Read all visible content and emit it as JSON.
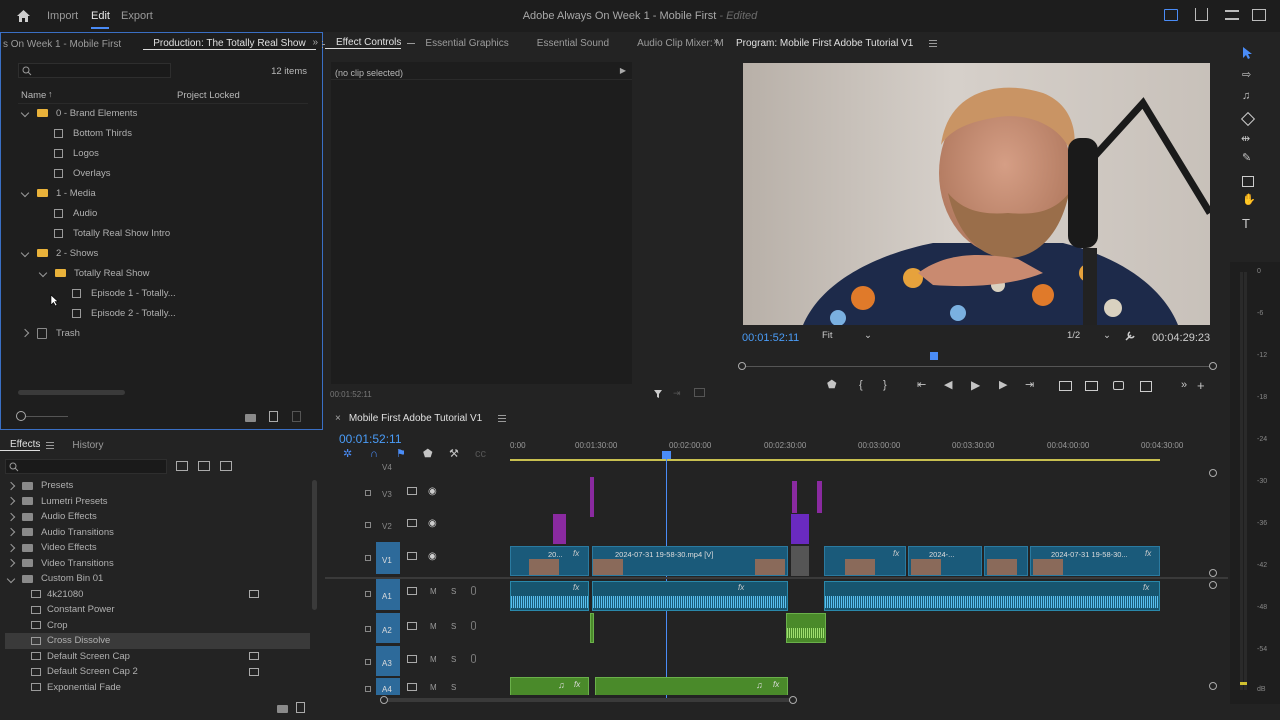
{
  "app": {
    "title": "Adobe Always On Week 1 - Mobile First",
    "edited": "- Edited"
  },
  "topnav": {
    "import": "Import",
    "edit": "Edit",
    "export": "Export"
  },
  "colors": {
    "accent": "#4a8cf7",
    "timecode": "#4a9cf7",
    "video_clip": "#1a5a7a",
    "audio_clip": "#17556f",
    "green_clip": "#4a8a2a",
    "purple_clip": "#8a2aa0",
    "folder": "#e9b23a"
  },
  "project": {
    "tab_prev": "s On Week 1 - Mobile First",
    "tab_active": "Production: The Totally Real Show",
    "items_count": "12 items",
    "col_name": "Name",
    "col_locked": "Project Locked",
    "rows": [
      {
        "label": "0 - Brand Elements",
        "type": "folder"
      },
      {
        "label": "Bottom Thirds",
        "type": "bin"
      },
      {
        "label": "Logos",
        "type": "bin"
      },
      {
        "label": "Overlays",
        "type": "bin"
      },
      {
        "label": "1 - Media",
        "type": "folder"
      },
      {
        "label": "Audio",
        "type": "bin"
      },
      {
        "label": "Totally Real Show Intro",
        "type": "bin"
      },
      {
        "label": "2 - Shows",
        "type": "folder"
      },
      {
        "label": "Totally Real Show",
        "type": "folder"
      },
      {
        "label": "Episode 1 - Totally...",
        "type": "bin"
      },
      {
        "label": "Episode 2 - Totally...",
        "type": "bin"
      },
      {
        "label": "Trash",
        "type": "trash"
      }
    ]
  },
  "effect_controls": {
    "tabs": [
      "Effect Controls",
      "Essential Graphics",
      "Essential Sound",
      "Audio Clip Mixer: M"
    ],
    "no_clip": "(no clip selected)",
    "timecode": "00:01:52:11"
  },
  "program": {
    "title": "Program: Mobile First Adobe Tutorial V1",
    "timecode": "00:01:52:11",
    "fit": "Fit",
    "resolution": "1/2",
    "duration": "00:04:29:23"
  },
  "effects": {
    "tab_active": "Effects",
    "tab_history": "History",
    "items": [
      {
        "label": "Presets",
        "kind": "folder"
      },
      {
        "label": "Lumetri Presets",
        "kind": "folder"
      },
      {
        "label": "Audio Effects",
        "kind": "folder"
      },
      {
        "label": "Audio Transitions",
        "kind": "folder"
      },
      {
        "label": "Video Effects",
        "kind": "folder"
      },
      {
        "label": "Video Transitions",
        "kind": "folder"
      },
      {
        "label": "Custom Bin 01",
        "kind": "folder-open"
      },
      {
        "label": "4k21080",
        "kind": "effect"
      },
      {
        "label": "Constant Power",
        "kind": "effect"
      },
      {
        "label": "Crop",
        "kind": "effect"
      },
      {
        "label": "Cross Dissolve",
        "kind": "effect"
      },
      {
        "label": "Default Screen Cap",
        "kind": "effect"
      },
      {
        "label": "Default Screen Cap 2",
        "kind": "effect"
      },
      {
        "label": "Exponential Fade",
        "kind": "effect"
      }
    ]
  },
  "timeline": {
    "title": "Mobile First Adobe Tutorial V1",
    "timecode": "00:01:52:11",
    "ruler": [
      "0:00",
      "00:01:30:00",
      "00:02:00:00",
      "00:02:30:00",
      "00:03:00:00",
      "00:03:30:00",
      "00:04:00:00",
      "00:04:30:00"
    ],
    "tracks": [
      {
        "name": "V4",
        "kind": "video"
      },
      {
        "name": "V3",
        "kind": "video"
      },
      {
        "name": "V2",
        "kind": "video"
      },
      {
        "name": "V1",
        "kind": "video"
      },
      {
        "name": "A1",
        "kind": "audio"
      },
      {
        "name": "A2",
        "kind": "audio"
      },
      {
        "name": "A3",
        "kind": "audio"
      },
      {
        "name": "A4",
        "kind": "audio"
      }
    ],
    "clip_labels": {
      "c1": "20...",
      "c2": "2024-07-31 19-58-30.mp4 [V]",
      "c3": "2024-...",
      "c4": "2024-07-31 19-58-30..."
    },
    "m": "M",
    "s": "S",
    "fx": "fx"
  },
  "meter": {
    "scale": [
      "0",
      "-6",
      "-12",
      "-18",
      "-24",
      "-30",
      "-36",
      "-42",
      "-48",
      "-54",
      "dB"
    ]
  }
}
